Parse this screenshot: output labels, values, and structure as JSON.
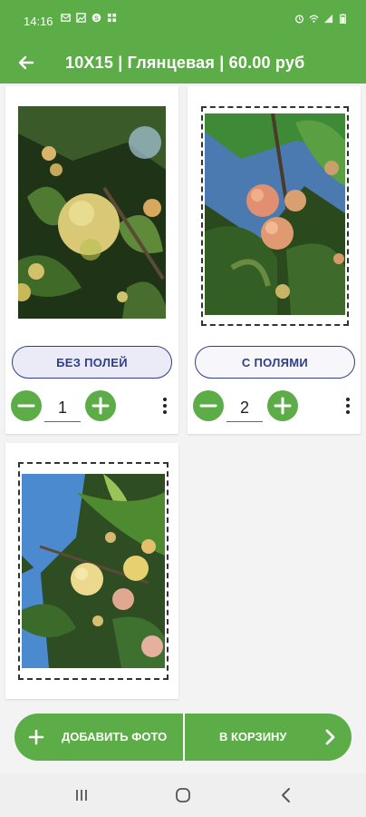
{
  "status_bar": {
    "time": "14:16",
    "left_icons": [
      "mail-icon",
      "photo-icon",
      "skype-icon",
      "grid-icon"
    ],
    "right_icons": [
      "alarm-icon",
      "wifi-icon",
      "signal-icon",
      "battery-icon"
    ]
  },
  "app_bar": {
    "title": "10X15 | Глянцевая | 60.00 руб",
    "back_icon": "arrow-left-icon"
  },
  "photos": [
    {
      "option_label": "БЕЗ ПОЛЕЙ",
      "quantity": "1",
      "selected": true
    },
    {
      "option_label": "С ПОЛЯМИ",
      "quantity": "2",
      "selected": false
    },
    {
      "option_label": "",
      "quantity": "",
      "selected": false
    }
  ],
  "bottom_actions": {
    "add_photo_label": "ДОБАВИТЬ ФОТО",
    "to_cart_label": "В КОРЗИНУ"
  },
  "colors": {
    "accent_green": "#5cad47",
    "pill_text_blue": "#2f3f8a"
  }
}
